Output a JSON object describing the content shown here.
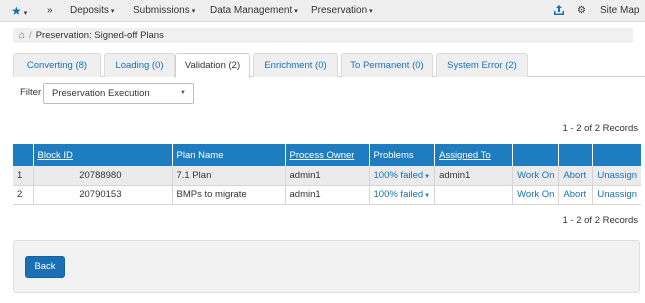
{
  "nav": {
    "menu_items": [
      {
        "label": "Deposits"
      },
      {
        "label": "Submissions"
      },
      {
        "label": "Data Management"
      },
      {
        "label": "Preservation"
      }
    ],
    "site_map_label": "Site Map"
  },
  "breadcrumb": {
    "current": "Preservation: Signed-off Plans"
  },
  "tabs": [
    {
      "label": "Converting (8)"
    },
    {
      "label": "Loading (0)"
    },
    {
      "label": "Validation (2)",
      "active": true
    },
    {
      "label": "Enrichment (0)"
    },
    {
      "label": "To Permanent (0)"
    },
    {
      "label": "System Error (2)"
    }
  ],
  "filter": {
    "label": "Filter",
    "selected": "Preservation Execution"
  },
  "records_text": "1 - 2 of 2 Records",
  "table": {
    "headers": [
      "Block ID",
      "Plan Name",
      "Process Owner",
      "Problems",
      "Assigned To"
    ],
    "rows": [
      {
        "index": "1",
        "block_id": "20788980",
        "plan_name": "7.1 Plan",
        "process_owner": "admin1",
        "problems": "100% failed",
        "assigned_to": "admin1",
        "work_on": "Work On",
        "abort": "Abort",
        "unassign": "Unassign"
      },
      {
        "index": "2",
        "block_id": "20790153",
        "plan_name": "BMPs to migrate",
        "process_owner": "admin1",
        "problems": "100% failed",
        "assigned_to": "",
        "work_on": "Work On",
        "abort": "Abort",
        "unassign": "Unassign"
      }
    ]
  },
  "back_button": "Back",
  "colors": {
    "accent": "#1a6fb5",
    "header_bg": "#1e7dc1",
    "topbar_bg": "#efefef"
  }
}
